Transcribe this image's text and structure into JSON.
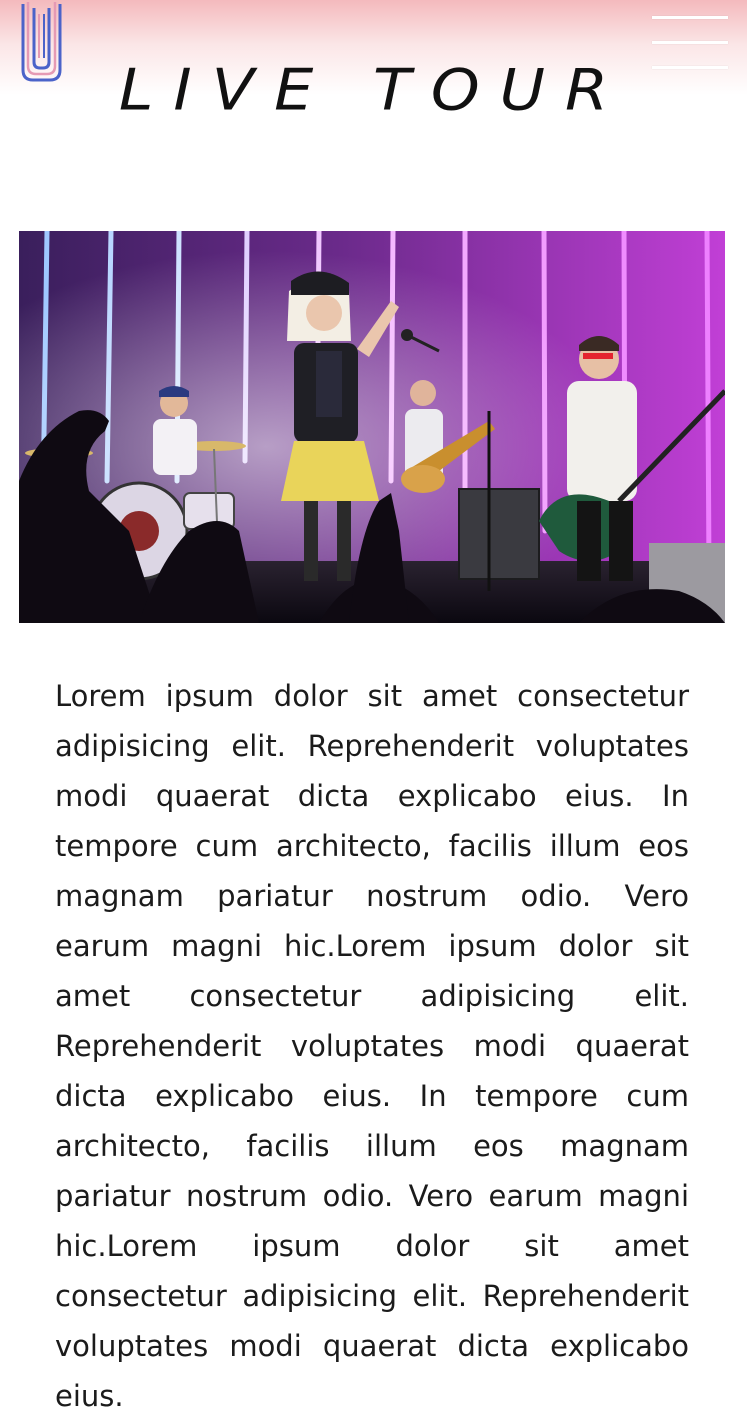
{
  "header": {
    "title": "LIVE TOUR",
    "logo_icon": "band-logo-icon",
    "menu_icon": "hamburger-menu-icon"
  },
  "hero": {
    "image": "concert-stage-photo"
  },
  "content": {
    "paragraph": "Lorem ipsum dolor sit amet consectetur adipisicing elit. Reprehenderit voluptates modi quaerat dicta explicabo eius. In tempore cum architecto, facilis illum eos magnam pariatur nostrum odio. Vero earum magni hic.Lorem ipsum dolor sit amet consectetur adipisicing elit. Reprehenderit voluptates modi quaerat dicta explicabo eius. In tempore cum architecto, facilis illum eos magnam pariatur nostrum odio. Vero earum magni hic.Lorem ipsum dolor sit amet consectetur adipisicing elit. Reprehenderit voluptates modi quaerat dicta explicabo eius."
  },
  "colors": {
    "header_gradient_top": "#f4b9bd",
    "logo_blue": "#4b63c9",
    "logo_pink": "#e59ab4",
    "stage_purple": "#b12fcf"
  }
}
